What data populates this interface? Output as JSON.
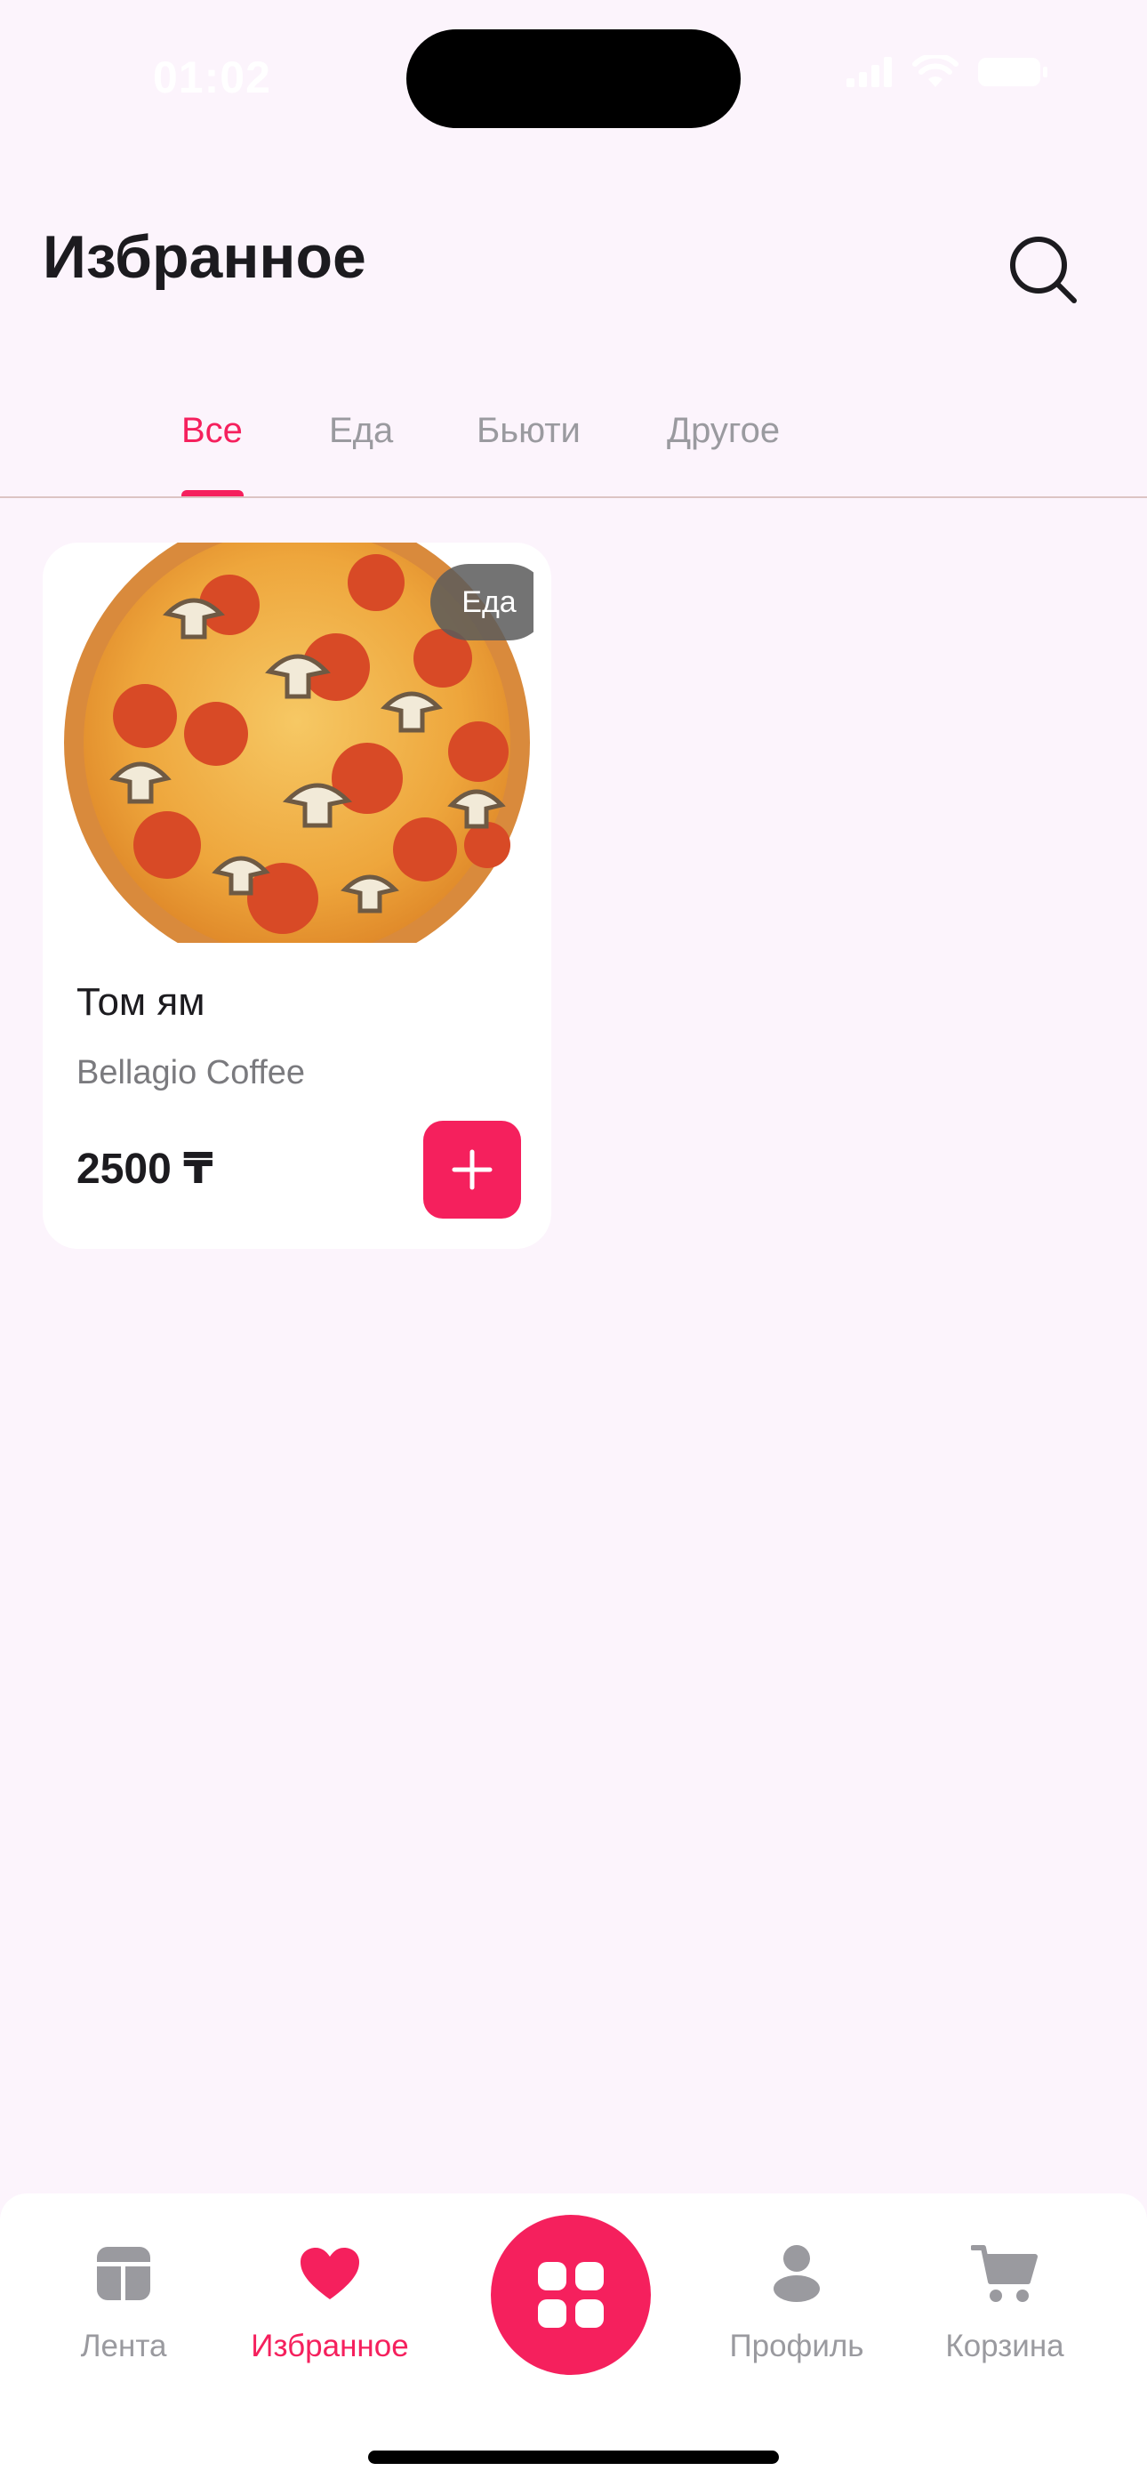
{
  "status_bar": {
    "time": "01:02"
  },
  "header": {
    "title": "Избранное",
    "search_icon": "search-icon"
  },
  "tabs": [
    {
      "label": "Все",
      "active": true
    },
    {
      "label": "Еда",
      "active": false
    },
    {
      "label": "Бьюти",
      "active": false
    },
    {
      "label": "Другое",
      "active": false
    }
  ],
  "products": [
    {
      "name": "Том ям",
      "store": "Bellagio Coffee",
      "price": "2500 ₸",
      "category_badge": "Еда",
      "image_icon": "pizza-image",
      "add_icon": "plus-icon"
    }
  ],
  "bottom_nav": {
    "items": [
      {
        "label": "Лента",
        "icon": "feed-icon",
        "active": false
      },
      {
        "label": "Избранное",
        "icon": "heart-icon",
        "active": true
      },
      {
        "label": "Профиль",
        "icon": "profile-icon",
        "active": false
      },
      {
        "label": "Корзина",
        "icon": "cart-icon",
        "active": false
      }
    ],
    "center_icon": "grid-icon"
  },
  "colors": {
    "accent": "#f5205d",
    "background": "#fcf4fc",
    "text_primary": "#1c1b1f",
    "text_secondary": "#9a9a9f"
  }
}
